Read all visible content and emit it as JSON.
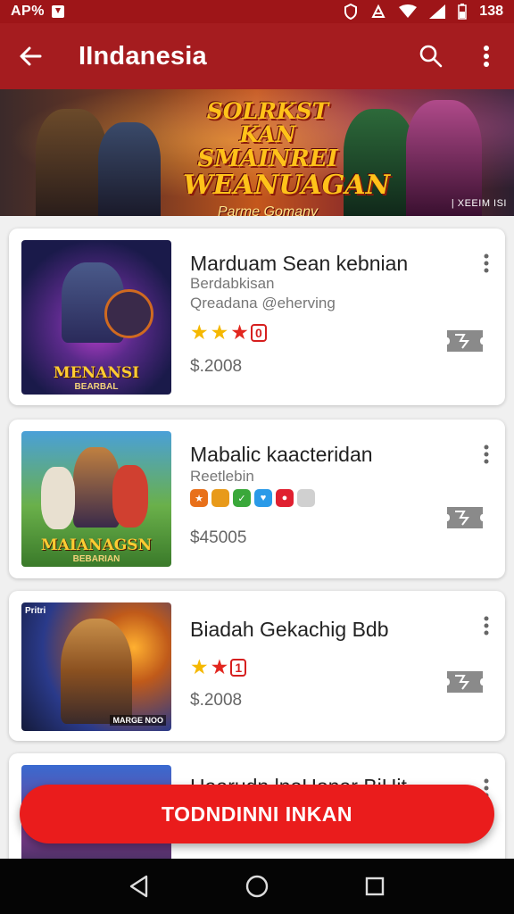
{
  "status_bar": {
    "left_text": "AP%",
    "time": "138"
  },
  "app_bar": {
    "title": "IIndanesia"
  },
  "banner": {
    "line1": "SOLRKST KAN",
    "line2": "SMAINREI",
    "line3": "WEANUAGAN",
    "subtitle": "Parme Gomany",
    "tag": "| XEEIM ISI"
  },
  "cards": [
    {
      "title": "Marduam Sean kebnian",
      "subtitle": "Berdabkisan",
      "subtitle2": "Qreadana @eherving",
      "rating_badge": "0",
      "price": "$.2008",
      "thumb_label": "MENANSI",
      "thumb_label2": "BEARBAL"
    },
    {
      "title": "Mabalic kaacteridan",
      "subtitle": "Reetlebin",
      "price": "$45005",
      "thumb_label": "MAIANAGSN",
      "thumb_label2": "BEBARIAN"
    },
    {
      "title": "Biadah Gekachig  Bdb",
      "rating_badge": "1",
      "price": "$.2008",
      "thumb_top": "Pritri",
      "thumb_label2": "MARGE NOO"
    },
    {
      "title": "Haarudn lnoHonar BiHit"
    }
  ],
  "action_button": {
    "label": "TODNDINNI INKAN"
  },
  "colors": {
    "primary": "#a51c1f",
    "status_bar": "#9e1518",
    "accent": "#ea1c1c",
    "star": "#f5b800"
  },
  "icons": [
    "back-arrow-icon",
    "search-icon",
    "more-vert-icon",
    "star-icon",
    "ticket-icon",
    "nav-back-icon",
    "nav-home-icon",
    "nav-recents-icon"
  ]
}
